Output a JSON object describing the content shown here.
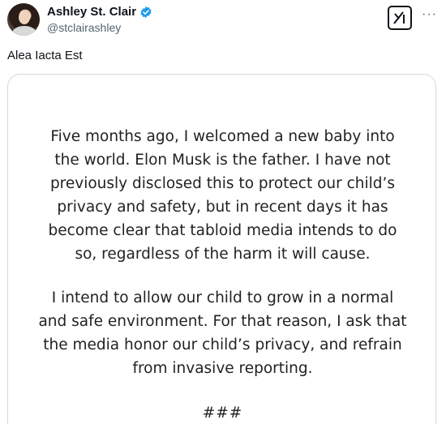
{
  "author": {
    "display_name": "Ashley St. Clair",
    "handle": "@stclairashley"
  },
  "tweet": {
    "text": "Alea Iacta Est"
  },
  "statement": {
    "paragraph1": "Five months ago, I welcomed a new baby into\nthe world. Elon Musk is the father. I have not\npreviously disclosed this to protect our child’s\nprivacy and safety, but in recent days it has\nbecome clear that tabloid media intends to do\nso, regardless of the harm it will cause.",
    "paragraph2": "I intend to allow our child to grow in a normal\nand safe environment. For that reason, I ask that\nthe media honor our child’s privacy, and refrain\nfrom invasive reporting.",
    "closing": "###"
  },
  "icons": {
    "verified": "verified-badge-icon",
    "grok": "grok-icon",
    "more": "more-options-icon"
  },
  "colors": {
    "verified_blue": "#1d9bf0",
    "text_primary": "#0f1419",
    "text_secondary": "#536471"
  }
}
